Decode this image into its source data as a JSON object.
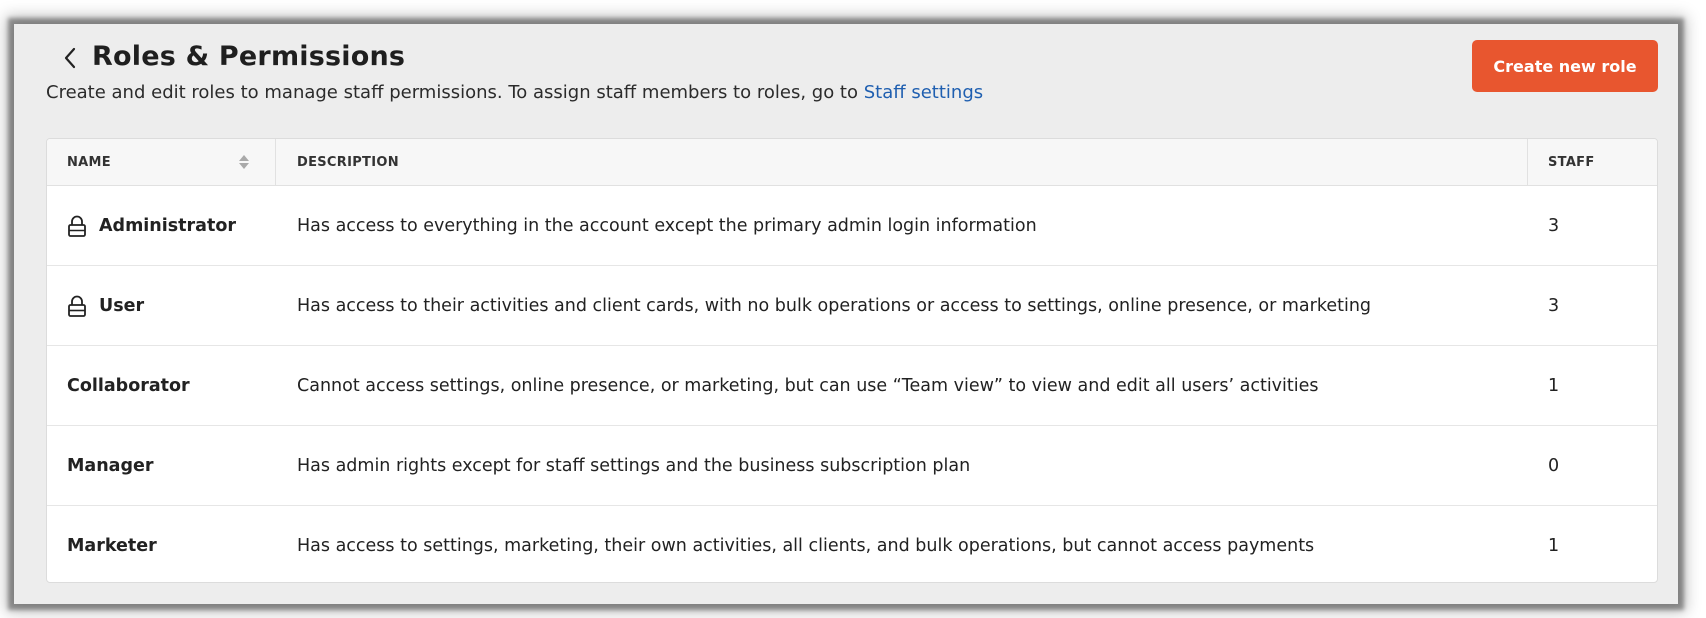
{
  "header": {
    "title": "Roles & Permissions",
    "subtitle_text": "Create and edit roles to manage staff permissions. To assign staff members to roles, go to ",
    "subtitle_link": "Staff settings",
    "create_button_label": "Create new role",
    "back_icon": "chevron-left-icon"
  },
  "colors": {
    "accent": "#e8562f",
    "link": "#1f5fb0",
    "background": "#ededed"
  },
  "table": {
    "columns": {
      "name": "NAME",
      "description": "DESCRIPTION",
      "staff": "STAFF"
    },
    "sort_icon": "sort-icon",
    "rows": [
      {
        "name": "Administrator",
        "locked": true,
        "description": "Has access to everything in the account except the primary admin login information",
        "staff": "3"
      },
      {
        "name": "User",
        "locked": true,
        "description": "Has access to their activities and client cards, with no bulk operations or access to settings, online presence, or marketing",
        "staff": "3"
      },
      {
        "name": "Collaborator",
        "locked": false,
        "description": "Cannot access settings, online presence, or marketing, but can use “Team view” to view and edit all users’ activities",
        "staff": "1"
      },
      {
        "name": "Manager",
        "locked": false,
        "description": "Has admin rights except for staff settings and the business subscription plan",
        "staff": "0"
      },
      {
        "name": "Marketer",
        "locked": false,
        "description": "Has access to settings, marketing, their own activities, all clients, and bulk operations, but cannot access payments",
        "staff": "1"
      }
    ]
  }
}
